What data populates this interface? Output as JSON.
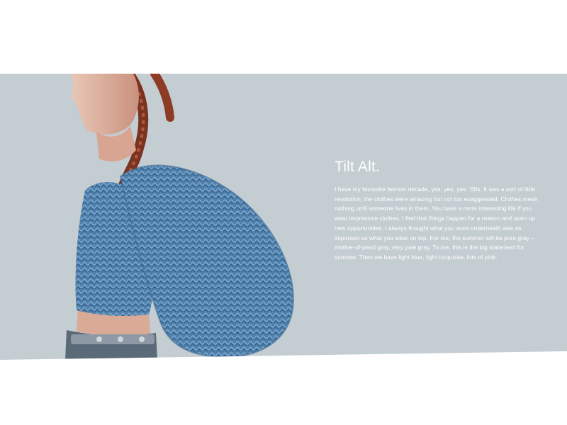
{
  "hero": {
    "title": "Tilt Alt.",
    "body": "I have my favourite fashion decade, yes, yes, yes: '60s. It was a sort of little revolution; the clothes were amazing but not too exaggerated. Clothes mean nothing until someone lives in them. You have a more interesting life if you wear impressive clothes. I feel that things happen for a reason and open up new opportunities. I always thought what you wore underneath was as important as what you wear on top. For me, the summer will be pure gray – mother-of-pearl gray, very pale gray. To me, this is the big statement for summer. Then we have light blue, light turquoise, lots of pink.",
    "image": "model in textured blue knit top"
  },
  "colors": {
    "background": "#ffffff",
    "band": "#c4cdd2",
    "text": "#ffffff",
    "knit": "#4e7fab"
  }
}
